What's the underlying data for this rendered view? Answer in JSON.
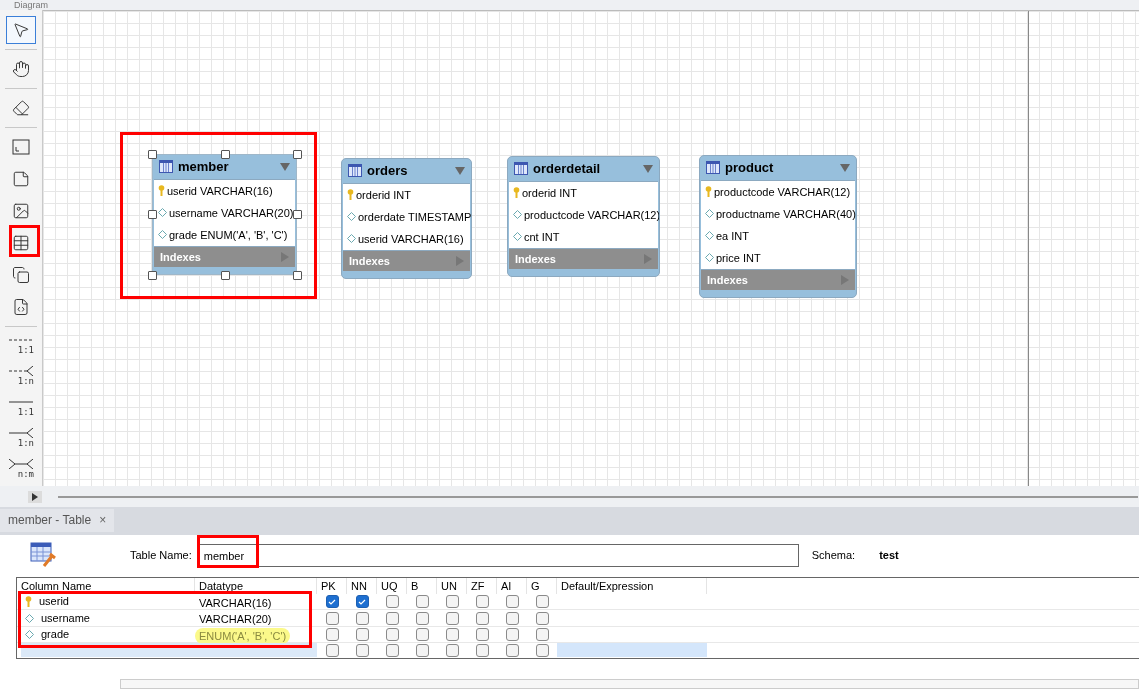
{
  "diagram": {
    "title": "Diagram"
  },
  "toolbar": {
    "tools": [
      {
        "kind": "pointer",
        "selected": true,
        "highlighted": false
      },
      {
        "kind": "hand",
        "selected": false,
        "highlighted": false
      },
      {
        "kind": "eraser",
        "selected": false,
        "highlighted": false
      },
      {
        "kind": "layer",
        "selected": false,
        "highlighted": false
      },
      {
        "kind": "note",
        "selected": false,
        "highlighted": false
      },
      {
        "kind": "image",
        "selected": false,
        "highlighted": false
      },
      {
        "kind": "table",
        "selected": false,
        "highlighted": true
      },
      {
        "kind": "view",
        "selected": false,
        "highlighted": false
      },
      {
        "kind": "routine",
        "selected": false,
        "highlighted": false
      },
      {
        "kind": "dashed_one",
        "label": "1:1",
        "selected": false,
        "highlighted": false
      },
      {
        "kind": "dashed_many",
        "label": "1:n",
        "selected": false,
        "highlighted": false
      },
      {
        "kind": "solid_one",
        "label": "1:1",
        "selected": false,
        "highlighted": false
      },
      {
        "kind": "solid_many",
        "label": "1:n",
        "selected": false,
        "highlighted": false
      },
      {
        "kind": "solid_both",
        "label": "n:m",
        "selected": false,
        "highlighted": false
      }
    ]
  },
  "entities": [
    {
      "name": "member",
      "selected": true,
      "highlighted": true,
      "indexes": "Indexes",
      "columns": [
        {
          "name": "userid VARCHAR(16)",
          "pk": true
        },
        {
          "name": "username VARCHAR(20)",
          "pk": false
        },
        {
          "name": "grade ENUM('A', 'B', 'C')",
          "pk": false
        }
      ]
    },
    {
      "name": "orders",
      "selected": false,
      "highlighted": false,
      "indexes": "Indexes",
      "columns": [
        {
          "name": "orderid INT",
          "pk": true
        },
        {
          "name": "orderdate TIMESTAMP",
          "pk": false
        },
        {
          "name": "userid VARCHAR(16)",
          "pk": false
        }
      ]
    },
    {
      "name": "orderdetail",
      "selected": false,
      "highlighted": false,
      "indexes": "Indexes",
      "columns": [
        {
          "name": "orderid INT",
          "pk": true
        },
        {
          "name": "productcode VARCHAR(12)",
          "pk": false
        },
        {
          "name": "cnt INT",
          "pk": false
        }
      ]
    },
    {
      "name": "product",
      "selected": false,
      "highlighted": false,
      "indexes": "Indexes",
      "columns": [
        {
          "name": "productcode VARCHAR(12)",
          "pk": true
        },
        {
          "name": "productname VARCHAR(40)",
          "pk": false
        },
        {
          "name": "ea INT",
          "pk": false
        },
        {
          "name": "price INT",
          "pk": false
        }
      ]
    }
  ],
  "editor": {
    "tab": {
      "label": "member - Table",
      "close": "×",
      "selected": true
    },
    "table_name_label": "Table Name:",
    "table_name": "member",
    "table_name_highlighted": true,
    "schema_label": "Schema:",
    "schema": "test",
    "grid": {
      "columns": [
        "Column Name",
        "Datatype",
        "PK",
        "NN",
        "UQ",
        "B",
        "UN",
        "ZF",
        "AI",
        "G",
        "Default/Expression"
      ],
      "rows_highlighted": true,
      "rows": [
        {
          "name": "userid",
          "datatype": "VARCHAR(16)",
          "pk": true,
          "datatype_highlighted": false,
          "flags": [
            true,
            true,
            false,
            false,
            false,
            false,
            false,
            false
          ]
        },
        {
          "name": "username",
          "datatype": "VARCHAR(20)",
          "pk": false,
          "datatype_highlighted": false,
          "flags": [
            false,
            false,
            false,
            false,
            false,
            false,
            false,
            false
          ]
        },
        {
          "name": "grade",
          "datatype": "ENUM('A', 'B', 'C')",
          "pk": false,
          "datatype_highlighted": true,
          "flags": [
            false,
            false,
            false,
            false,
            false,
            false,
            false,
            false
          ]
        }
      ],
      "new_row_flags": [
        false,
        false,
        false,
        false,
        false,
        false,
        false,
        false
      ]
    }
  }
}
